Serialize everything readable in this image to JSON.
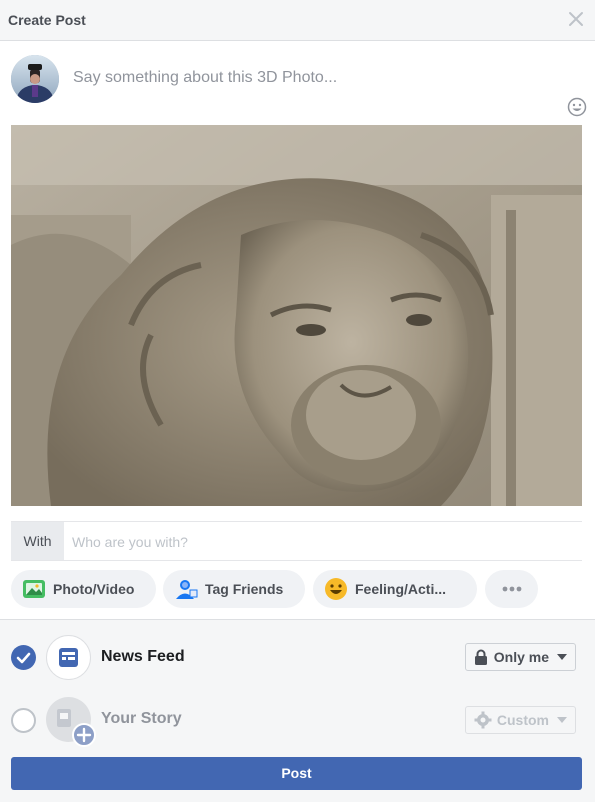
{
  "header": {
    "title": "Create Post",
    "close_icon": "close-icon"
  },
  "composer": {
    "placeholder": "Say something about this 3D Photo...",
    "emoji_icon": "smiley-icon"
  },
  "photo": {
    "subject": "lion-sculpture-3d-photo"
  },
  "with_row": {
    "label": "With",
    "placeholder": "Who are you with?"
  },
  "actions": [
    {
      "label": "Photo/Video",
      "icon": "photo-video-icon"
    },
    {
      "label": "Tag Friends",
      "icon": "tag-friends-icon"
    },
    {
      "label": "Feeling/Acti...",
      "icon": "feeling-icon"
    },
    {
      "label": "",
      "icon": "more-icon"
    }
  ],
  "destinations": {
    "news_feed": {
      "label": "News Feed",
      "checked": true,
      "privacy": "Only me",
      "privacy_icon": "lock-icon"
    },
    "your_story": {
      "label": "Your Story",
      "checked": false,
      "privacy": "Custom",
      "privacy_icon": "gear-icon"
    }
  },
  "post_button": "Post",
  "colors": {
    "brand": "#4267b2",
    "check": "#4267b2"
  }
}
